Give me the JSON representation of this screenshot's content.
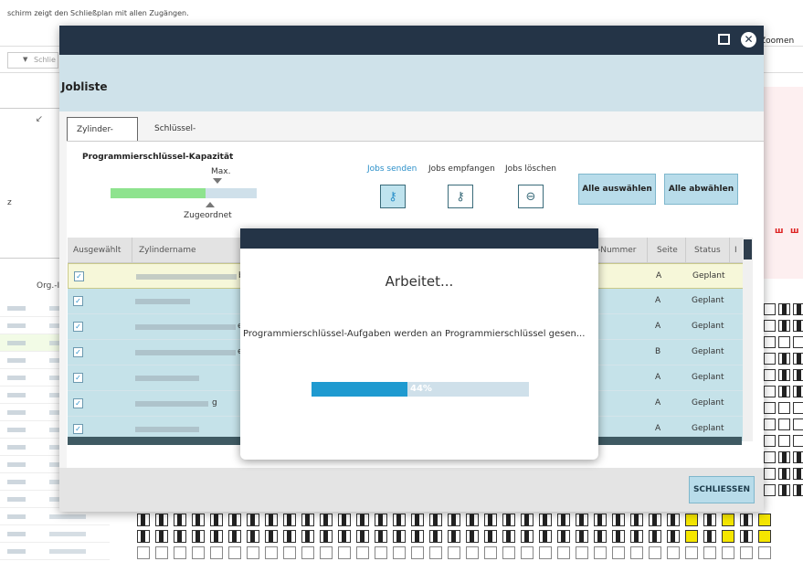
{
  "background": {
    "hint_text": "schirm zeigt den Schließplan mit allen Zugängen.",
    "select_text": "Schlie",
    "zoom_label": "Zoomen",
    "left_letter": "z",
    "org_label": "Org.-I"
  },
  "modal": {
    "title": "Jobliste",
    "tabs": [
      {
        "label": "Zylinder-Jobs",
        "active": true
      },
      {
        "label": "Schlüssel-Jobs",
        "active": false
      }
    ],
    "capacity": {
      "title": "Programmierschlüssel-Kapazität",
      "max_label": "Max.",
      "assigned_label": "Zugeordnet",
      "assigned_fraction": 0.65
    },
    "actions": [
      {
        "label": "Jobs senden",
        "icon": "key-send-icon"
      },
      {
        "label": "Jobs empfangen",
        "icon": "key-receive-icon"
      },
      {
        "label": "Jobs löschen",
        "icon": "minus-circle-icon"
      }
    ],
    "select_all": "Alle auswählen",
    "deselect_all": "Alle abwählen",
    "table": {
      "columns": [
        "Ausgewählt",
        "Zylindername",
        "-Nummer",
        "Seite",
        "Status",
        "I"
      ],
      "rows": [
        {
          "name_suffix": "bei I",
          "side": "A",
          "status": "Geplant"
        },
        {
          "name_suffix": "",
          "side": "A",
          "status": "Geplant"
        },
        {
          "name_suffix": "er. T",
          "side": "A",
          "status": "Geplant"
        },
        {
          "name_suffix": "er. T",
          "side": "B",
          "status": "Geplant"
        },
        {
          "name_suffix": "",
          "side": "A",
          "status": "Geplant"
        },
        {
          "name_suffix": "g",
          "side": "A",
          "status": "Geplant"
        },
        {
          "name_suffix": "",
          "side": "A",
          "status": "Geplant"
        }
      ]
    },
    "close_label": "SCHLIESSEN"
  },
  "busy": {
    "title": "Arbeitet...",
    "message": "Programmierschlüssel-Aufgaben werden an Programmierschlüssel gesen...",
    "progress_fraction": 0.44,
    "progress_text": "44%"
  },
  "colors": {
    "dark_bar": "#243447",
    "accent_blue": "#1f9ad0",
    "capacity_green": "#8ee38e",
    "row_teal": "#c5e2e9"
  }
}
